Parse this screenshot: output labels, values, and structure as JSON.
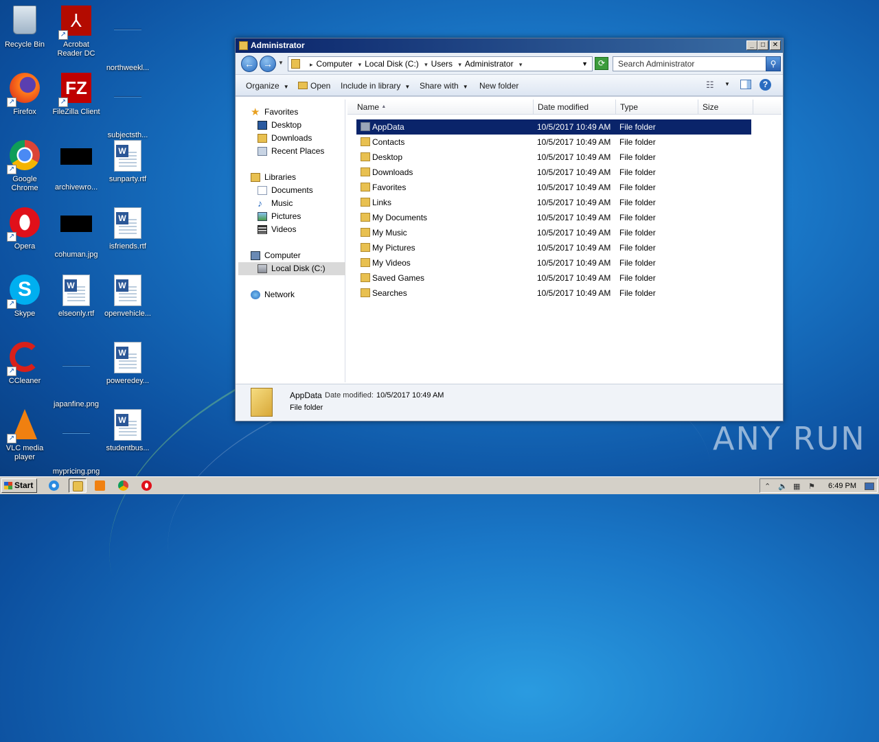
{
  "desktop": {
    "icons": [
      {
        "label": "Recycle Bin"
      },
      {
        "label": "Acrobat Reader DC"
      },
      {
        "label": "northweekl..."
      },
      {
        "label": "Firefox"
      },
      {
        "label": "FileZilla Client"
      },
      {
        "label": "subjectsth..."
      },
      {
        "label": "Google Chrome"
      },
      {
        "label": "archivewro..."
      },
      {
        "label": "sunparty.rtf"
      },
      {
        "label": "Opera"
      },
      {
        "label": "cohuman.jpg"
      },
      {
        "label": "isfriends.rtf"
      },
      {
        "label": "Skype"
      },
      {
        "label": "elseonly.rtf"
      },
      {
        "label": "openvehicle..."
      },
      {
        "label": "CCleaner"
      },
      {
        "label": "japanfine.png"
      },
      {
        "label": "poweredey..."
      },
      {
        "label": "VLC media player"
      },
      {
        "label": "mypricing.png"
      },
      {
        "label": "studentbus..."
      }
    ],
    "watermark": "ANY RUN"
  },
  "window": {
    "title": "Administrator",
    "controls": {
      "minimize": "_",
      "maximize": "□",
      "close": "✕"
    },
    "breadcrumb": [
      "Computer",
      "Local Disk (C:)",
      "Users",
      "Administrator"
    ],
    "search_placeholder": "Search Administrator",
    "toolbar": {
      "organize": "Organize",
      "open": "Open",
      "include": "Include in library",
      "share": "Share with",
      "new_folder": "New folder"
    },
    "nav": {
      "favorites": "Favorites",
      "desktop": "Desktop",
      "downloads": "Downloads",
      "recent": "Recent Places",
      "libraries": "Libraries",
      "documents": "Documents",
      "music": "Music",
      "pictures": "Pictures",
      "videos": "Videos",
      "computer": "Computer",
      "local_disk": "Local Disk (C:)",
      "network": "Network"
    },
    "columns": {
      "name": "Name",
      "date": "Date modified",
      "type": "Type",
      "size": "Size"
    },
    "rows": [
      {
        "name": "AppData",
        "date": "10/5/2017 10:49 AM",
        "type": "File folder"
      },
      {
        "name": "Contacts",
        "date": "10/5/2017 10:49 AM",
        "type": "File folder"
      },
      {
        "name": "Desktop",
        "date": "10/5/2017 10:49 AM",
        "type": "File folder"
      },
      {
        "name": "Downloads",
        "date": "10/5/2017 10:49 AM",
        "type": "File folder"
      },
      {
        "name": "Favorites",
        "date": "10/5/2017 10:49 AM",
        "type": "File folder"
      },
      {
        "name": "Links",
        "date": "10/5/2017 10:49 AM",
        "type": "File folder"
      },
      {
        "name": "My Documents",
        "date": "10/5/2017 10:49 AM",
        "type": "File folder"
      },
      {
        "name": "My Music",
        "date": "10/5/2017 10:49 AM",
        "type": "File folder"
      },
      {
        "name": "My Pictures",
        "date": "10/5/2017 10:49 AM",
        "type": "File folder"
      },
      {
        "name": "My Videos",
        "date": "10/5/2017 10:49 AM",
        "type": "File folder"
      },
      {
        "name": "Saved Games",
        "date": "10/5/2017 10:49 AM",
        "type": "File folder"
      },
      {
        "name": "Searches",
        "date": "10/5/2017 10:49 AM",
        "type": "File folder"
      }
    ],
    "details": {
      "name": "AppData",
      "date_label": "Date modified:",
      "date": "10/5/2017 10:49 AM",
      "type": "File folder"
    }
  },
  "taskbar": {
    "start": "Start",
    "clock": "6:49 PM"
  }
}
